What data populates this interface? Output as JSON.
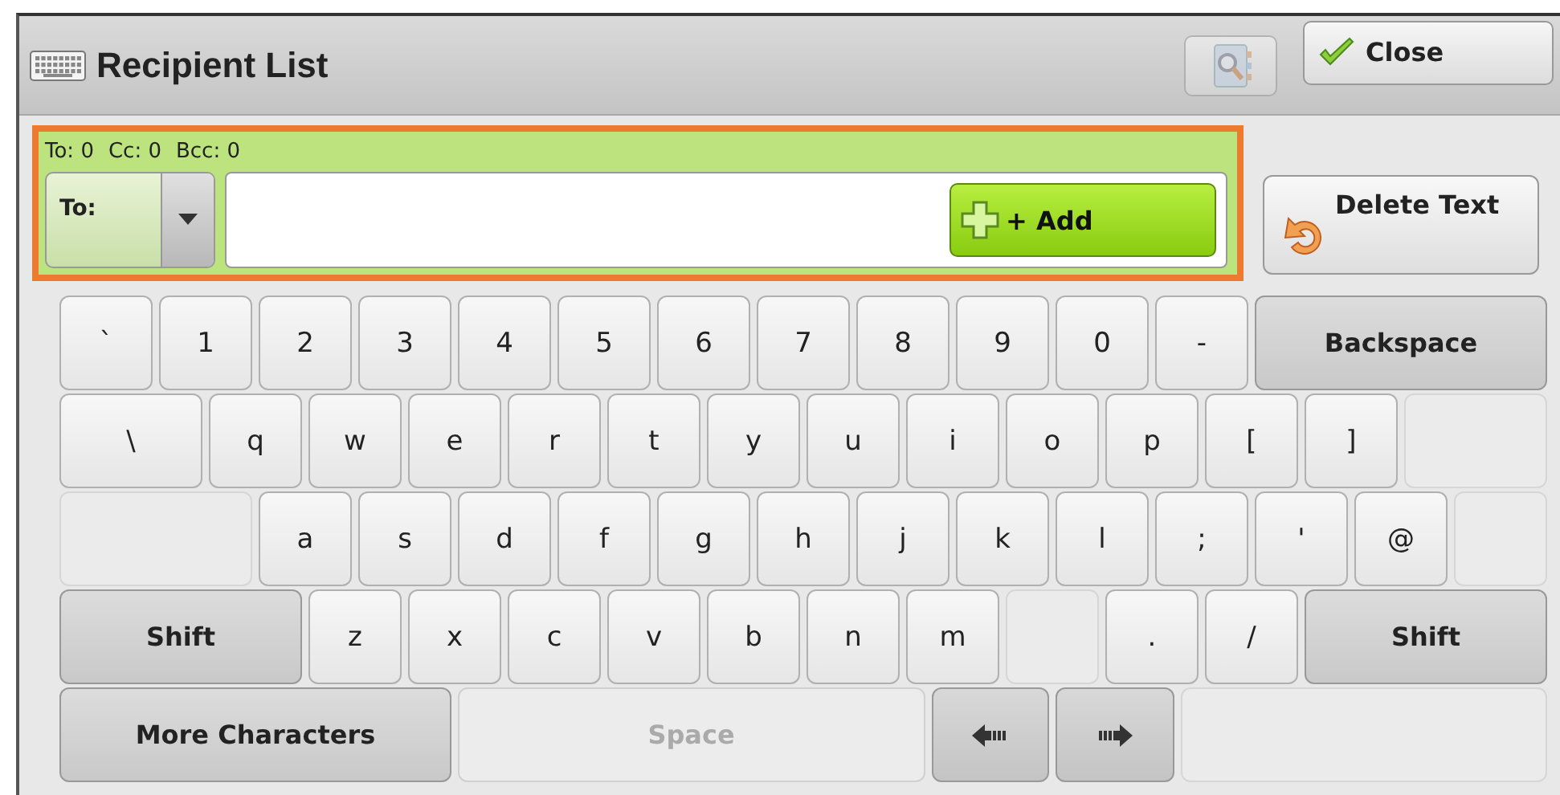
{
  "window": {
    "title": "Recipient List"
  },
  "header_buttons": [
    {
      "kind": "address-book",
      "disabled": true
    },
    {
      "kind": "close",
      "label": "Close"
    }
  ],
  "recipients": {
    "counts": [
      "To: 0",
      "Cc: 0",
      "Bcc: 0"
    ],
    "field_type": "To:",
    "add_label": "+ Add"
  },
  "delete_text": {
    "label": "Delete Text"
  },
  "keyboard": {
    "key_rows": [
      {
        "keys": [
          {
            "kind": "char",
            "label": "`"
          },
          {
            "kind": "char",
            "label": "1"
          },
          {
            "kind": "char",
            "label": "2"
          },
          {
            "kind": "char",
            "label": "3"
          },
          {
            "kind": "char",
            "label": "4"
          },
          {
            "kind": "char",
            "label": "5"
          },
          {
            "kind": "char",
            "label": "6"
          },
          {
            "kind": "char",
            "label": "7"
          },
          {
            "kind": "char",
            "label": "8"
          },
          {
            "kind": "char",
            "label": "9"
          },
          {
            "kind": "char",
            "label": "0"
          },
          {
            "kind": "char",
            "label": "-"
          },
          {
            "kind": "function",
            "label": "Backspace"
          }
        ]
      },
      {
        "keys": [
          {
            "kind": "char",
            "label": "\\"
          },
          {
            "kind": "char",
            "label": "q"
          },
          {
            "kind": "char",
            "label": "w"
          },
          {
            "kind": "char",
            "label": "e"
          },
          {
            "kind": "char",
            "label": "r"
          },
          {
            "kind": "char",
            "label": "t"
          },
          {
            "kind": "char",
            "label": "y"
          },
          {
            "kind": "char",
            "label": "u"
          },
          {
            "kind": "char",
            "label": "i"
          },
          {
            "kind": "char",
            "label": "o"
          },
          {
            "kind": "char",
            "label": "p"
          },
          {
            "kind": "char",
            "label": "["
          },
          {
            "kind": "char",
            "label": "]"
          },
          {
            "kind": "blank"
          }
        ]
      },
      {
        "keys": [
          {
            "kind": "blank"
          },
          {
            "kind": "char",
            "label": "a"
          },
          {
            "kind": "char",
            "label": "s"
          },
          {
            "kind": "char",
            "label": "d"
          },
          {
            "kind": "char",
            "label": "f"
          },
          {
            "kind": "char",
            "label": "g"
          },
          {
            "kind": "char",
            "label": "h"
          },
          {
            "kind": "char",
            "label": "j"
          },
          {
            "kind": "char",
            "label": "k"
          },
          {
            "kind": "char",
            "label": "l"
          },
          {
            "kind": "char",
            "label": ";"
          },
          {
            "kind": "char",
            "label": "'"
          },
          {
            "kind": "char",
            "label": "@"
          },
          {
            "kind": "blank"
          }
        ]
      },
      {
        "keys": [
          {
            "kind": "function",
            "label": "Shift"
          },
          {
            "kind": "char",
            "label": "z"
          },
          {
            "kind": "char",
            "label": "x"
          },
          {
            "kind": "char",
            "label": "c"
          },
          {
            "kind": "char",
            "label": "v"
          },
          {
            "kind": "char",
            "label": "b"
          },
          {
            "kind": "char",
            "label": "n"
          },
          {
            "kind": "char",
            "label": "m"
          },
          {
            "kind": "blank"
          },
          {
            "kind": "char",
            "label": "."
          },
          {
            "kind": "char",
            "label": "/"
          },
          {
            "kind": "function",
            "label": "Shift"
          }
        ]
      },
      {
        "keys": [
          {
            "kind": "function",
            "label": "More Characters"
          },
          {
            "kind": "space",
            "label": "Space",
            "disabled": true
          },
          {
            "kind": "arrow-left"
          },
          {
            "kind": "arrow-right"
          },
          {
            "kind": "blank"
          }
        ]
      }
    ]
  }
}
